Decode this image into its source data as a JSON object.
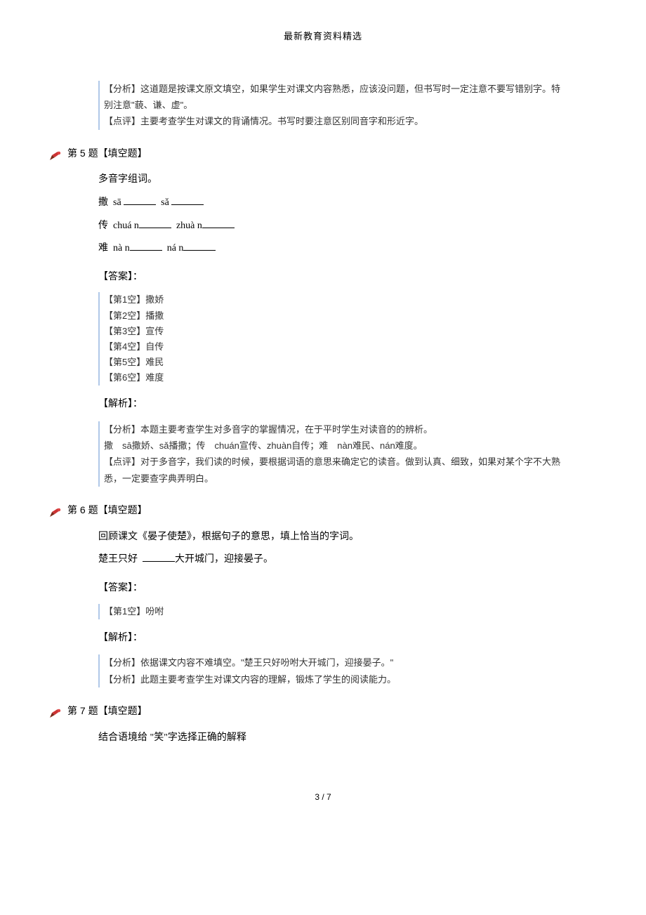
{
  "header": "最新教育资料精选",
  "block0": {
    "line1": "【分析】这道题是按课文原文填空，如果学生对课文内容熟悉，应该没问题，但书写时一定注意不要写错别字。特别注意\"藐、谦、虚\"。",
    "line2": "【点评】主要考查学生对课文的背诵情况。书写时要注意区别同音字和形近字。"
  },
  "q5": {
    "heading": "第 5 题【填空题】",
    "intro": "多音字组词。",
    "line_sa": "撒  sā ______  sǎ ______",
    "line_chuan": "传  chuán______  zhuàn______",
    "line_nan": "难  nàn______  nán______",
    "ans_label": "【答案】：",
    "ans": [
      "【第1空】撒娇",
      "【第2空】播撒",
      "【第3空】宣传",
      "【第4空】自传",
      "【第5空】难民",
      "【第6空】难度"
    ],
    "jiexi_label": "【解析】：",
    "jiexi": [
      "【分析】本题主要考查学生对多音字的掌握情况，在于平时学生对读音的的辨析。",
      "撒　sā撒娇、sǎ播撒；传　chuán宣传、zhuàn自传；难　nàn难民、nán难度。",
      "【点评】对于多音字，我们读的时候，要根据词语的意思来确定它的读音。做到认真、细致，如果对某个字不大熟悉，一定要查字典弄明白。"
    ]
  },
  "q6": {
    "heading": "第 6 题【填空题】",
    "intro": "回顾课文《晏子使楚》，根据句子的意思，填上恰当的字词。",
    "sentence": "楚王只好  ______大开城门，迎接晏子。",
    "ans_label": "【答案】：",
    "ans": [
      "【第1空】吩咐"
    ],
    "jiexi_label": "【解析】：",
    "jiexi": [
      "【分析】依据课文内容不难填空。\"楚王只好吩咐大开城门，迎接晏子。\"",
      "【分析】此题主要考查学生对课文内容的理解，锻炼了学生的阅读能力。"
    ]
  },
  "q7": {
    "heading": "第 7 题【填空题】",
    "intro": "结合语境给  \"笑\"字选择正确的解释"
  },
  "footer": "3 / 7"
}
